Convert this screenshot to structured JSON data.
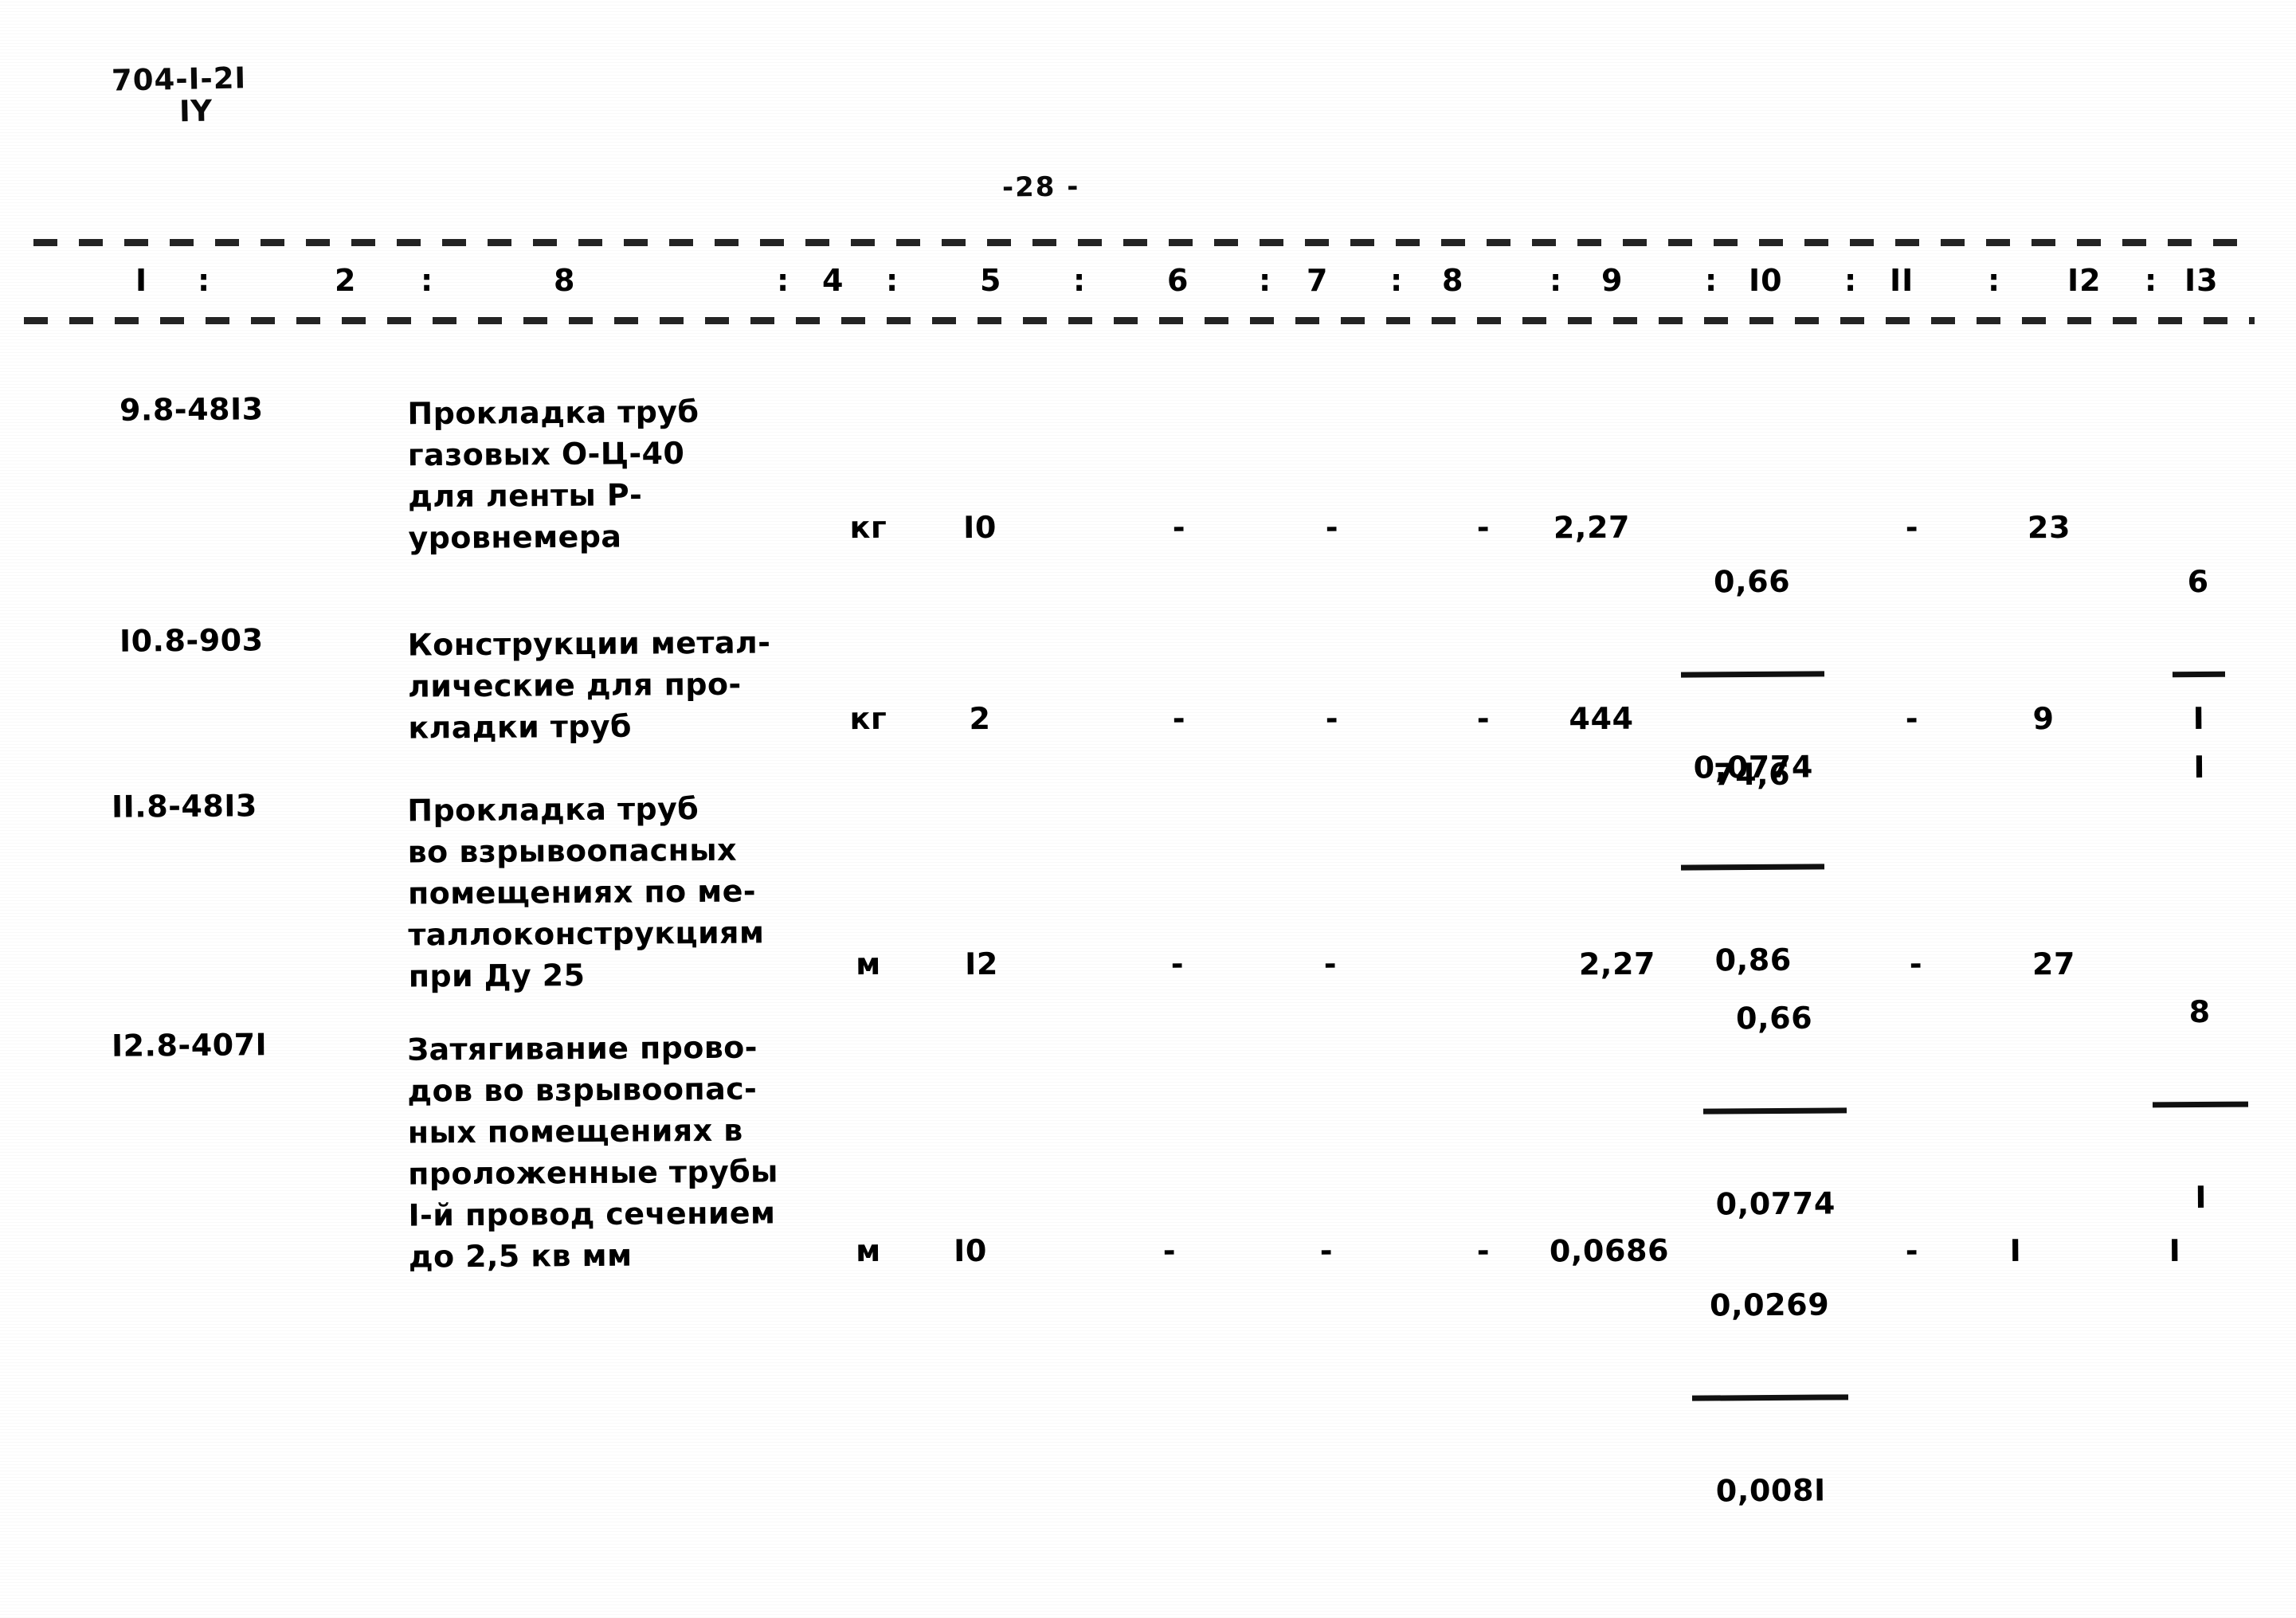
{
  "document": {
    "code": "704-I-2I",
    "series": "IY",
    "page_number": "-28 -"
  },
  "table": {
    "column_headers": [
      {
        "label": "I",
        "sep": ":"
      },
      {
        "label": "2",
        "sep": ":"
      },
      {
        "label": "8",
        "sep": ":"
      },
      {
        "label": "4",
        "sep": ":"
      },
      {
        "label": "5",
        "sep": ":"
      },
      {
        "label": "6",
        "sep": ":"
      },
      {
        "label": "7",
        "sep": ":"
      },
      {
        "label": "8",
        "sep": ":"
      },
      {
        "label": "9",
        "sep": ":"
      },
      {
        "label": "I0",
        "sep": ":"
      },
      {
        "label": "II",
        "sep": ":"
      },
      {
        "label": "I2",
        "sep": ":"
      },
      {
        "label": "I3",
        "sep": ""
      }
    ],
    "rows": [
      {
        "code": "9.8-48I3",
        "description": "Прокладка труб\nгазовых О-Ц-40\nдля ленты Р-\nуровнемера",
        "unit": "кг",
        "qty": "I0",
        "c6": "-",
        "c7": "-",
        "c8": "-",
        "c9": "2,27",
        "c10_num": "0,66",
        "c10_den": "0,0774",
        "c11": "-",
        "c12": "23",
        "c13_num": "6",
        "c13_den": "I"
      },
      {
        "code": "I0.8-903",
        "description": "Конструкции метал-\nлические для про-\nкладки труб",
        "unit": "кг",
        "qty": "2",
        "c6": "-",
        "c7": "-",
        "c8": "-",
        "c9": "444",
        "c10_num": "74,6",
        "c10_den": "0,86",
        "c11": "-",
        "c12": "9",
        "c13_num": "I",
        "c13_den": ""
      },
      {
        "code": "II.8-48I3",
        "description": "Прокладка труб\nво взрывоопасных\nпомещениях по ме-\nталлоконструкциям\nпри Ду 25",
        "unit": "м",
        "qty": "I2",
        "c6": "-",
        "c7": "-",
        "c8": "",
        "c9": "2,27",
        "c10_num": "0,66",
        "c10_den": "0,0774",
        "c11": "-",
        "c12": "27",
        "c13_num": "8",
        "c13_den": "I"
      },
      {
        "code": "I2.8-407I",
        "description": "Затягивание прово-\nдов во взрывоопас-\nных помещениях в\nпроложенные трубы\nI-й провод сечением\nдо 2,5 кв мм",
        "unit": "м",
        "qty": "I0",
        "c6": "-",
        "c7": "-",
        "c8": "-",
        "c9": "0,0686",
        "c10_num": "0,0269",
        "c10_den": "0,008I",
        "c11": "-",
        "c12": "I",
        "c13_num": "I",
        "c13_den": ""
      }
    ]
  }
}
